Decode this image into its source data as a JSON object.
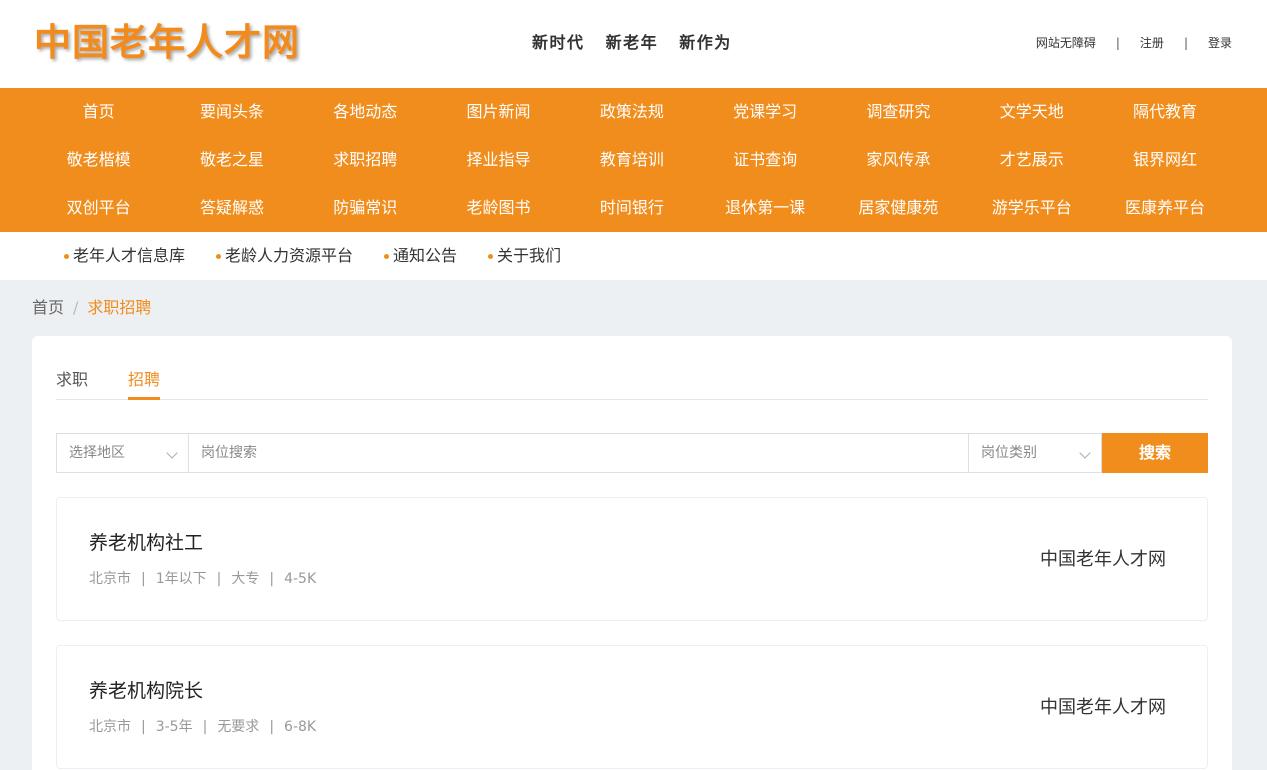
{
  "header": {
    "logo": "中国老年人才网",
    "slogan": [
      "新时代",
      "新老年",
      "新作为"
    ],
    "links": {
      "accessibility": "网站无障碍",
      "register": "注册",
      "login": "登录",
      "separator": "|"
    }
  },
  "nav": {
    "rows": [
      [
        "首页",
        "要闻头条",
        "各地动态",
        "图片新闻",
        "政策法规",
        "党课学习",
        "调查研究",
        "文学天地",
        "隔代教育"
      ],
      [
        "敬老楷模",
        "敬老之星",
        "求职招聘",
        "择业指导",
        "教育培训",
        "证书查询",
        "家风传承",
        "才艺展示",
        "银界网红"
      ],
      [
        "双创平台",
        "答疑解惑",
        "防骗常识",
        "老龄图书",
        "时间银行",
        "退休第一课",
        "居家健康苑",
        "游学乐平台",
        "医康养平台"
      ]
    ]
  },
  "subnav": [
    "老年人才信息库",
    "老龄人力资源平台",
    "通知公告",
    "关于我们"
  ],
  "breadcrumb": {
    "home": "首页",
    "separator": "/",
    "current": "求职招聘"
  },
  "tabs": [
    {
      "label": "求职",
      "active": false
    },
    {
      "label": "招聘",
      "active": true
    }
  ],
  "search": {
    "region_placeholder": "选择地区",
    "keyword_placeholder": "岗位搜索",
    "category_placeholder": "岗位类别",
    "button": "搜索"
  },
  "jobs": [
    {
      "title": "养老机构社工",
      "city": "北京市",
      "experience": "1年以下",
      "education": "大专",
      "salary": "4-5K",
      "company": "中国老年人才网"
    },
    {
      "title": "养老机构院长",
      "city": "北京市",
      "experience": "3-5年",
      "education": "无要求",
      "salary": "6-8K",
      "company": "中国老年人才网"
    }
  ],
  "meta_separator": "|",
  "colors": {
    "accent": "#f18d1d",
    "background": "#edf0f3"
  }
}
